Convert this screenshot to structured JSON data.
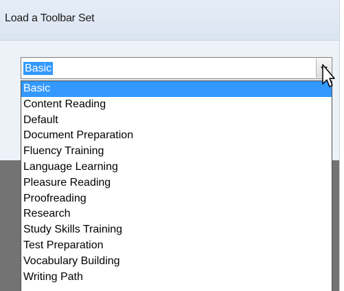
{
  "window": {
    "title": "Load a Toolbar Set"
  },
  "combo": {
    "value": "Basic"
  },
  "list": {
    "selected_index": 0,
    "items": [
      "Basic",
      "Content Reading",
      "Default",
      "Document Preparation",
      "Fluency Training",
      "Language Learning",
      "Pleasure Reading",
      "Proofreading",
      "Research",
      "Study Skills Training",
      "Test Preparation",
      "Vocabulary Building",
      "Writing Path"
    ]
  },
  "colors": {
    "selection": "#3399ff",
    "background_gray": "#737373",
    "dialog": "#edf2f9"
  },
  "icons": {
    "dropdown": "chevron-down-icon",
    "pointer": "mouse-cursor-icon"
  }
}
